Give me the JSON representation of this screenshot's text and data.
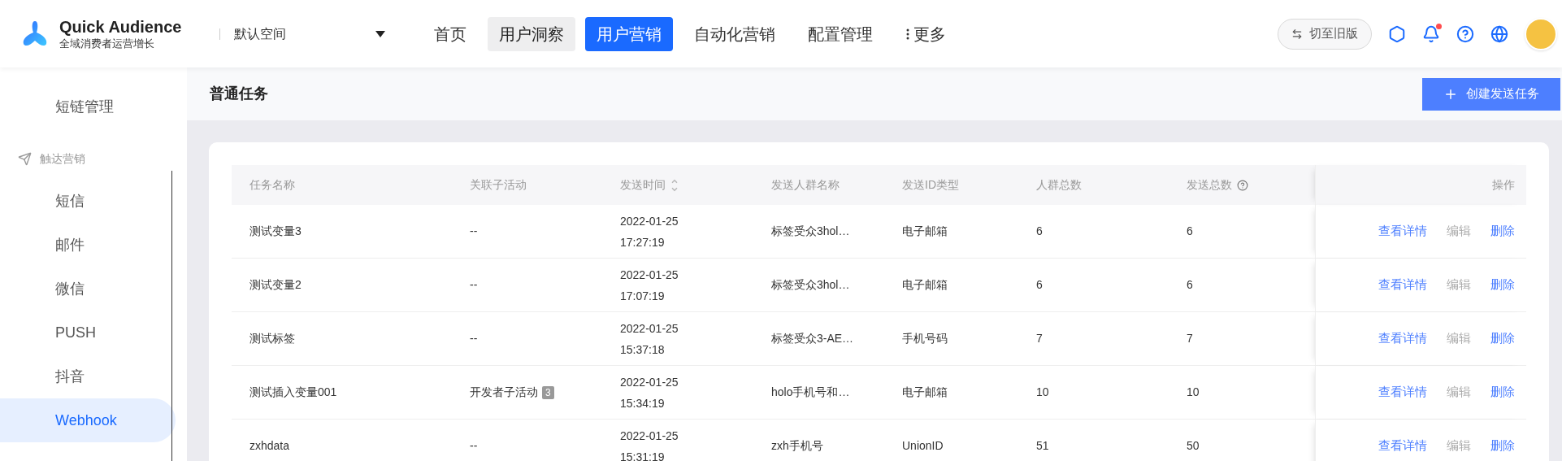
{
  "header": {
    "logo_title": "Quick Audience",
    "logo_subtitle": "全域消费者运营增长",
    "workspace": "默认空间",
    "nav": [
      {
        "label": "首页",
        "selected": false,
        "hovered": false
      },
      {
        "label": "用户洞察",
        "selected": false,
        "hovered": true
      },
      {
        "label": "用户营销",
        "selected": true,
        "hovered": false
      },
      {
        "label": "自动化营销",
        "selected": false,
        "hovered": false
      },
      {
        "label": "配置管理",
        "selected": false,
        "hovered": false
      },
      {
        "label": "更多",
        "selected": false,
        "hovered": false,
        "kind": "more"
      }
    ],
    "switch_version": "切至旧版",
    "notification_dot": true
  },
  "sidebar": {
    "items": [
      {
        "label": "短链管理",
        "kind": "item",
        "selected": false
      },
      {
        "label": "触达营销",
        "kind": "group"
      },
      {
        "label": "短信",
        "kind": "item",
        "selected": false
      },
      {
        "label": "邮件",
        "kind": "item",
        "selected": false
      },
      {
        "label": "微信",
        "kind": "item",
        "selected": false
      },
      {
        "label": "PUSH",
        "kind": "item",
        "selected": false
      },
      {
        "label": "抖音",
        "kind": "item",
        "selected": false
      },
      {
        "label": "Webhook",
        "kind": "item",
        "selected": true
      }
    ]
  },
  "page": {
    "title": "普通任务",
    "create_button": "创建发送任务"
  },
  "table": {
    "columns": [
      {
        "label": "任务名称"
      },
      {
        "label": "关联子活动"
      },
      {
        "label": "发送时间",
        "sortable": true
      },
      {
        "label": "发送人群名称"
      },
      {
        "label": "发送ID类型"
      },
      {
        "label": "人群总数"
      },
      {
        "label": "发送总数",
        "help": true
      },
      {
        "label": "操作"
      }
    ],
    "rows": [
      {
        "name": "测试变量3",
        "sub_activity": "--",
        "time": [
          "2022-01-25",
          "17:27:19"
        ],
        "group": "标签受众3hol…",
        "id_type": "电子邮箱",
        "group_total": "6",
        "sent_total": "6",
        "actions": [
          {
            "label": "查看详情",
            "disabled": false
          },
          {
            "label": "编辑",
            "disabled": true
          },
          {
            "label": "删除",
            "disabled": false
          }
        ]
      },
      {
        "name": "测试变量2",
        "sub_activity": "--",
        "time": [
          "2022-01-25",
          "17:07:19"
        ],
        "group": "标签受众3hol…",
        "id_type": "电子邮箱",
        "group_total": "6",
        "sent_total": "6",
        "actions": [
          {
            "label": "查看详情",
            "disabled": false
          },
          {
            "label": "编辑",
            "disabled": true
          },
          {
            "label": "删除",
            "disabled": false
          }
        ]
      },
      {
        "name": "测试标签",
        "sub_activity": "--",
        "time": [
          "2022-01-25",
          "15:37:18"
        ],
        "group": "标签受众3-AE…",
        "id_type": "手机号码",
        "group_total": "7",
        "sent_total": "7",
        "actions": [
          {
            "label": "查看详情",
            "disabled": false
          },
          {
            "label": "编辑",
            "disabled": true
          },
          {
            "label": "删除",
            "disabled": false
          }
        ]
      },
      {
        "name": "测试插入变量001",
        "sub_activity": "开发者子活动",
        "sub_activity_count": "3",
        "time": [
          "2022-01-25",
          "15:34:19"
        ],
        "group": "holo手机号和…",
        "id_type": "电子邮箱",
        "group_total": "10",
        "sent_total": "10",
        "actions": [
          {
            "label": "查看详情",
            "disabled": false
          },
          {
            "label": "编辑",
            "disabled": true
          },
          {
            "label": "删除",
            "disabled": false
          }
        ]
      },
      {
        "name": "zxhdata",
        "sub_activity": "--",
        "time": [
          "2022-01-25",
          "15:31:19"
        ],
        "group": "zxh手机号",
        "id_type": "UnionID",
        "group_total": "51",
        "sent_total": "50",
        "actions": [
          {
            "label": "查看详情",
            "disabled": false
          },
          {
            "label": "编辑",
            "disabled": true
          },
          {
            "label": "删除",
            "disabled": false
          }
        ]
      }
    ]
  }
}
